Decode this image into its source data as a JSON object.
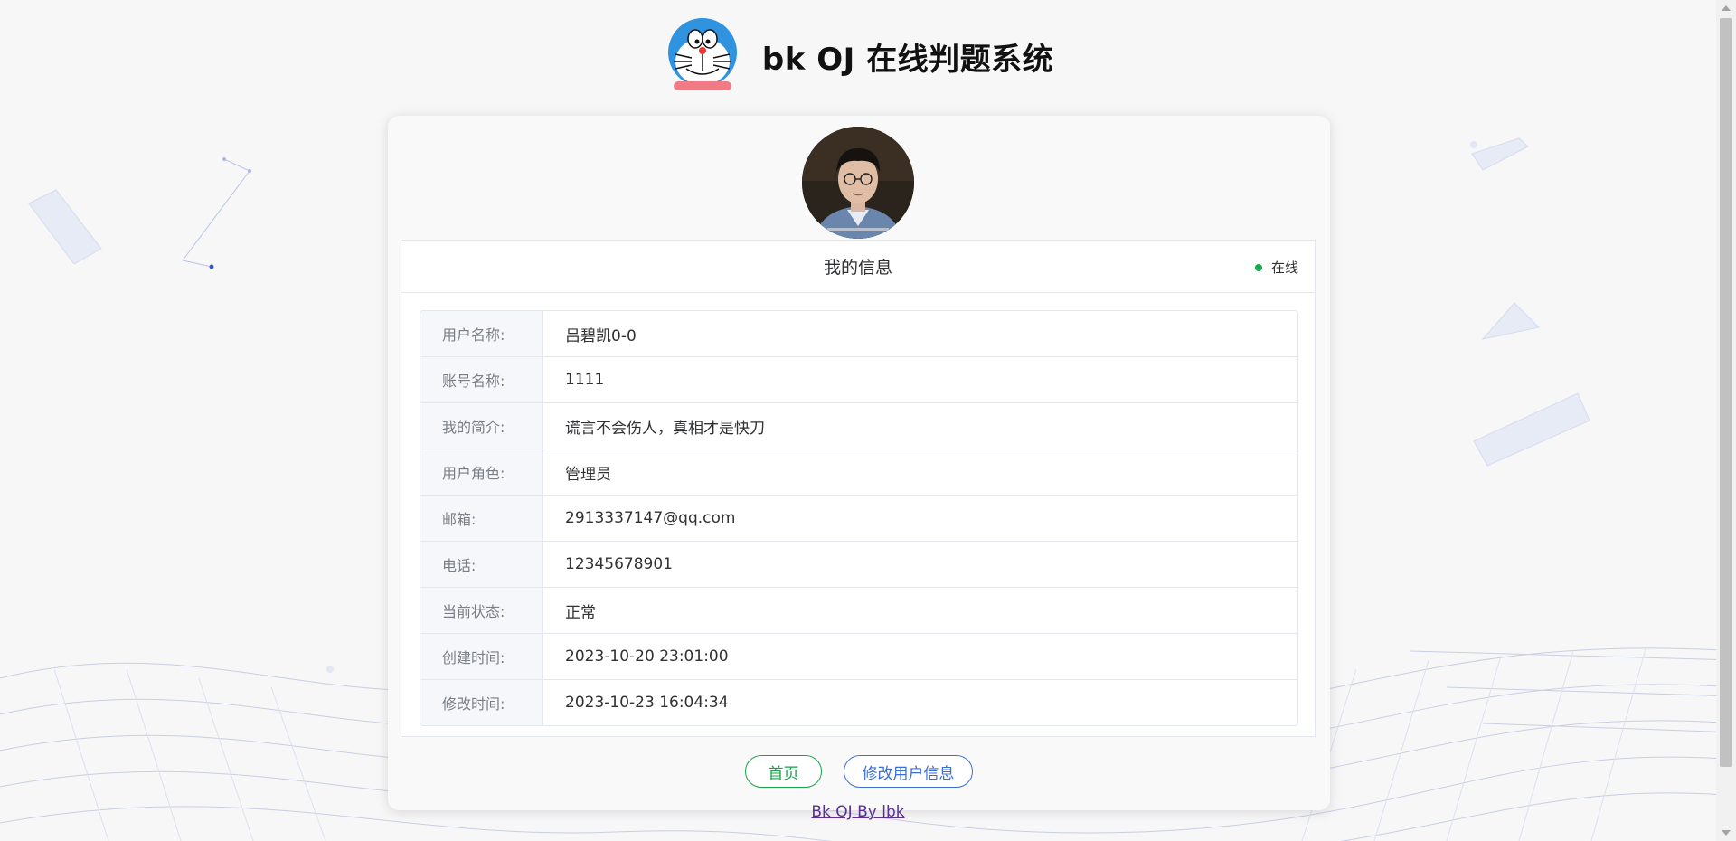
{
  "header": {
    "title": "bk OJ 在线判题系统"
  },
  "profile": {
    "panel_title": "我的信息",
    "status_text": "在线",
    "status_color": "#13a84b",
    "rows": [
      {
        "label": "用户名称:",
        "value": "吕碧凯0-0"
      },
      {
        "label": "账号名称:",
        "value": "1111"
      },
      {
        "label": "我的简介:",
        "value": "谎言不会伤人，真相才是快刀"
      },
      {
        "label": "用户角色:",
        "value": "管理员"
      },
      {
        "label": "邮箱:",
        "value": "2913337147@qq.com"
      },
      {
        "label": "电话:",
        "value": "12345678901"
      },
      {
        "label": "当前状态:",
        "value": "正常"
      },
      {
        "label": "创建时间:",
        "value": "2023-10-20 23:01:00"
      },
      {
        "label": "修改时间:",
        "value": "2023-10-23 16:04:34"
      }
    ]
  },
  "actions": {
    "home_label": "首页",
    "edit_label": "修改用户信息"
  },
  "footer": {
    "link_text": "Bk OJ By lbk"
  },
  "colors": {
    "home_button": "#16a34a",
    "edit_button": "#3b6fd8",
    "footer_link": "#5b2f94"
  }
}
